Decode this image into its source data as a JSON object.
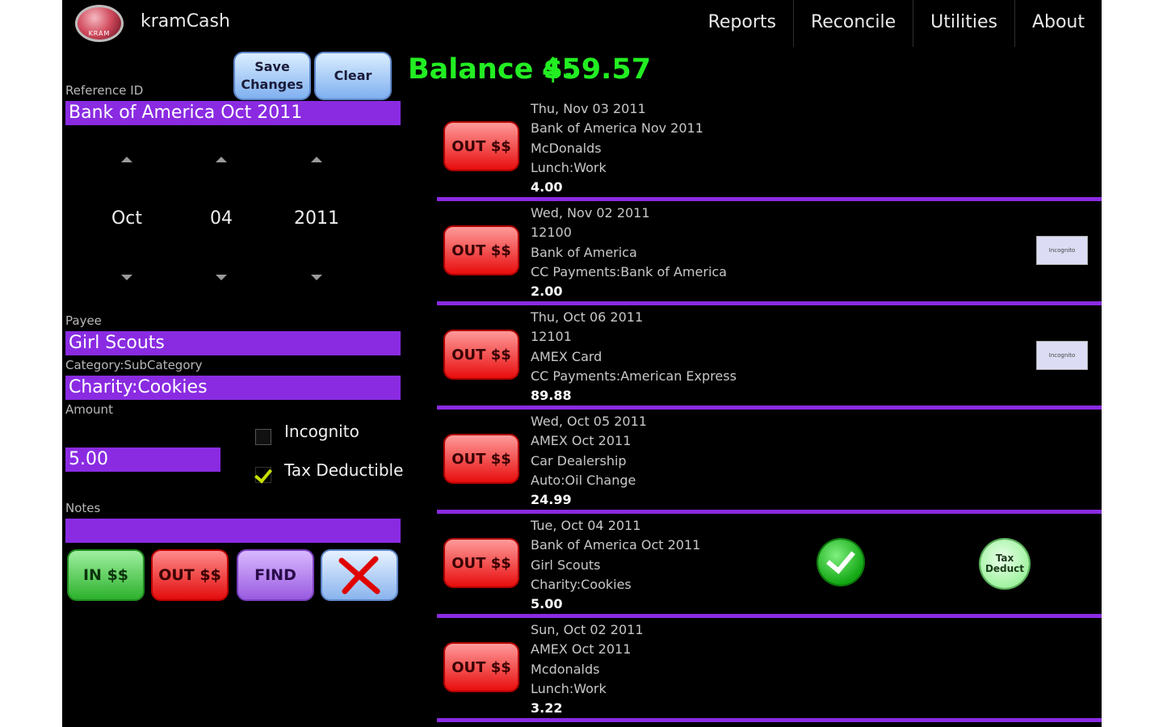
{
  "app": {
    "title": "kramCash",
    "logo_text": "KRAM"
  },
  "menu": [
    "Reports",
    "Reconcile",
    "Utilities",
    "About"
  ],
  "form": {
    "save_label_line1": "Save",
    "save_label_line2": "Changes",
    "clear_label": "Clear",
    "reference_label": "Reference ID",
    "reference_value": "Bank of America Oct 2011",
    "date": {
      "month": "Oct",
      "day": "04",
      "year": "2011"
    },
    "payee_label": "Payee",
    "payee_value": "Girl Scouts",
    "category_label": "Category:SubCategory",
    "category_value": "Charity:Cookies",
    "amount_label": "Amount",
    "amount_value": "5.00",
    "incognito_label": "Incognito",
    "incognito_checked": false,
    "tax_label": "Tax Deductible",
    "tax_checked": true,
    "notes_label": "Notes",
    "notes_value": "",
    "in_label": "IN $$",
    "out_label": "OUT $$",
    "find_label": "FIND"
  },
  "balance": {
    "label": "Balance $:",
    "value": "459.57"
  },
  "transactions": [
    {
      "button": "OUT $$",
      "date": "Thu, Nov 03 2011",
      "reference": "Bank of America Nov 2011",
      "payee": "McDonalds",
      "category": "Lunch:Work",
      "amount": "4.00",
      "incognito": false,
      "reconciled": false,
      "tax_deduct": false
    },
    {
      "button": "OUT $$",
      "date": "Wed, Nov 02 2011",
      "reference": "12100",
      "payee": "Bank of America",
      "category": "CC Payments:Bank of America",
      "amount": "2.00",
      "incognito": true,
      "reconciled": false,
      "tax_deduct": false
    },
    {
      "button": "OUT $$",
      "date": "Thu, Oct 06 2011",
      "reference": "12101",
      "payee": "AMEX Card",
      "category": "CC Payments:American Express",
      "amount": "89.88",
      "incognito": true,
      "reconciled": false,
      "tax_deduct": false
    },
    {
      "button": "OUT $$",
      "date": "Wed, Oct 05 2011",
      "reference": "AMEX Oct 2011",
      "payee": "Car Dealership",
      "category": "Auto:Oil Change",
      "amount": "24.99",
      "incognito": false,
      "reconciled": false,
      "tax_deduct": false
    },
    {
      "button": "OUT $$",
      "date": "Tue, Oct 04 2011",
      "reference": "Bank of America Oct 2011",
      "payee": "Girl Scouts",
      "category": "Charity:Cookies",
      "amount": "5.00",
      "incognito": false,
      "reconciled": true,
      "tax_deduct": true
    },
    {
      "button": "OUT $$",
      "date": "Sun, Oct 02 2011",
      "reference": "AMEX Oct 2011",
      "payee": "Mcdonalds",
      "category": "Lunch:Work",
      "amount": "3.22",
      "incognito": false,
      "reconciled": false,
      "tax_deduct": false
    }
  ],
  "badges": {
    "incognito_text": "Incognito",
    "tax_line1": "Tax",
    "tax_line2": "Deduct"
  },
  "colors": {
    "field": "#8a2be2",
    "balance": "#22ee22",
    "out": "#e80d0d",
    "in": "#2cb12c",
    "find": "#9a5be0"
  },
  "icons": {
    "delete": "red-x-icon",
    "reconciled": "green-check-icon",
    "tax": "tax-deduct-badge",
    "logo": "kram-logo-icon"
  }
}
